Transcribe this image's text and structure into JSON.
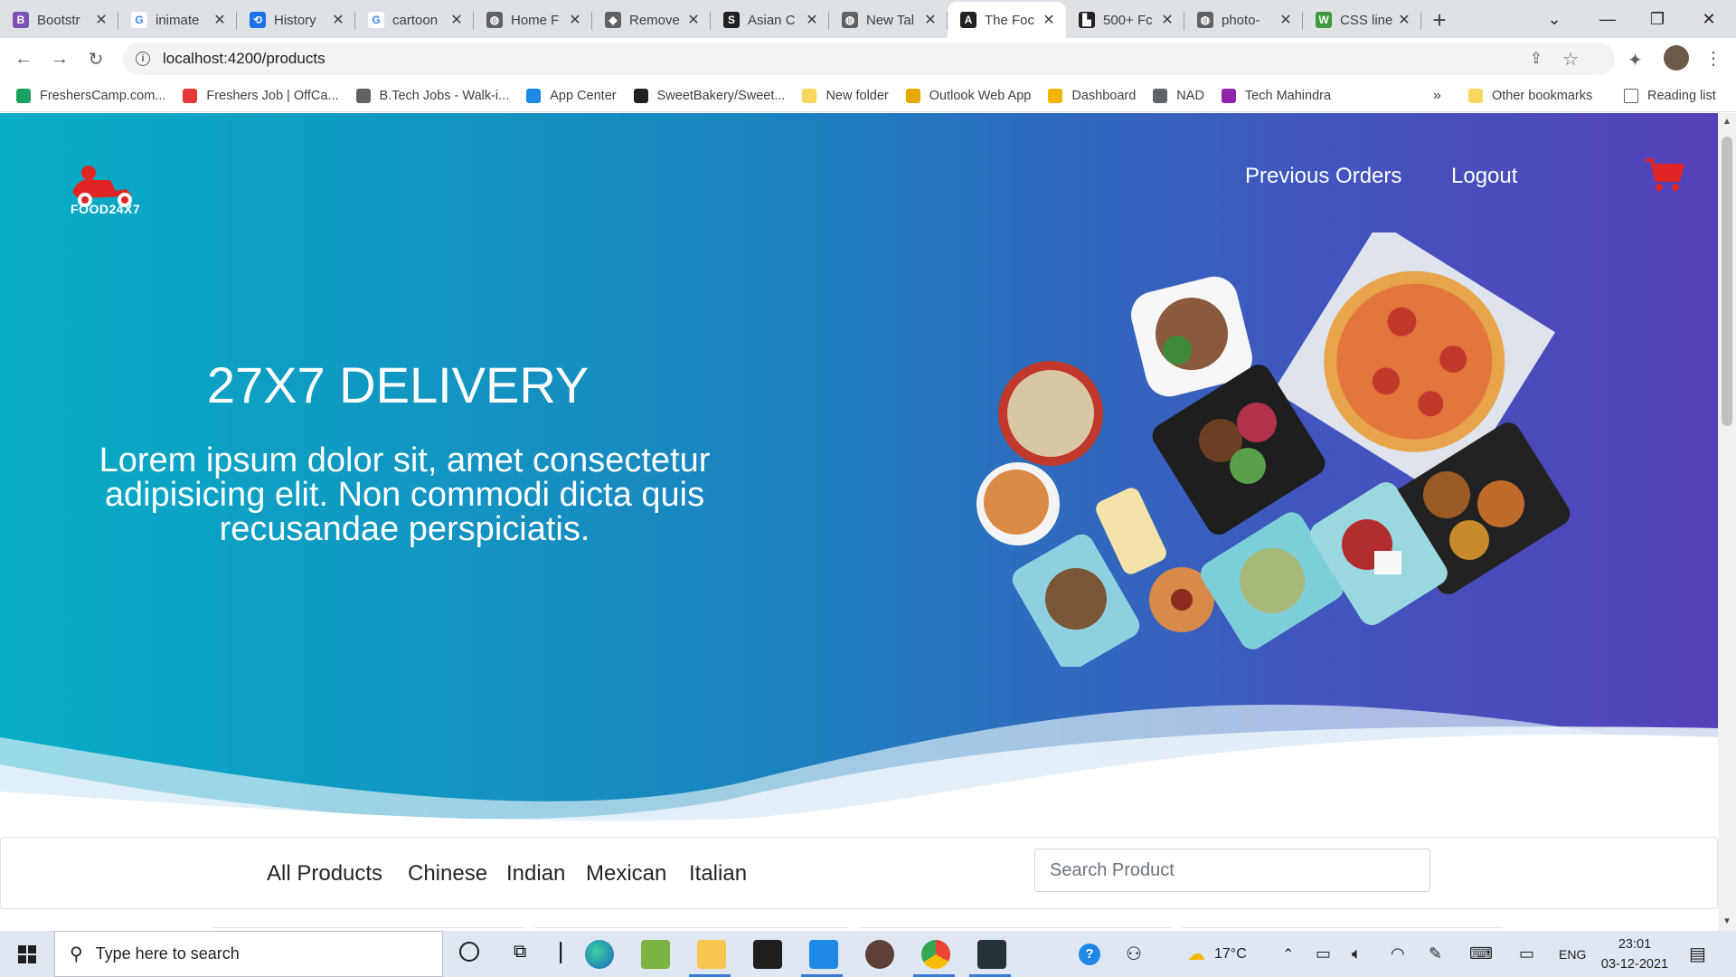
{
  "browser": {
    "tabs": [
      {
        "title": "Bootstr",
        "favicon_color": "#7952b3",
        "favicon_letter": "B",
        "active": false
      },
      {
        "title": "inimate",
        "favicon_color": "#ffffff",
        "favicon_letter": "G",
        "active": false
      },
      {
        "title": "History",
        "favicon_color": "#1a73e8",
        "favicon_letter": "⟲",
        "active": false
      },
      {
        "title": "cartoon",
        "favicon_color": "#ffffff",
        "favicon_letter": "G",
        "active": false
      },
      {
        "title": "Home F",
        "favicon_color": "#5f6368",
        "favicon_letter": "◍",
        "active": false
      },
      {
        "title": "Remove",
        "favicon_color": "#5f6368",
        "favicon_letter": "◆",
        "active": false
      },
      {
        "title": "Asian C",
        "favicon_color": "#202124",
        "favicon_letter": "S",
        "active": false
      },
      {
        "title": "New Tal",
        "favicon_color": "#5f6368",
        "favicon_letter": "◍",
        "active": false
      },
      {
        "title": "The Foc",
        "favicon_color": "#202124",
        "favicon_letter": "A",
        "active": true
      },
      {
        "title": "500+ Fc",
        "favicon_color": "#202124",
        "favicon_letter": "▙",
        "active": false
      },
      {
        "title": "photo-",
        "favicon_color": "#5f6368",
        "favicon_letter": "◍",
        "active": false
      },
      {
        "title": "CSS line",
        "favicon_color": "#3c9a3c",
        "favicon_letter": "W",
        "active": false
      }
    ],
    "url": "localhost:4200/products",
    "bookmarks": [
      {
        "label": "FreshersCamp.com...",
        "color": "#1aa260"
      },
      {
        "label": "Freshers Job | OffCa...",
        "color": "#e53935"
      },
      {
        "label": "B.Tech Jobs - Walk-i...",
        "color": "#5f6368"
      },
      {
        "label": "App Center",
        "color": "#1e88e5"
      },
      {
        "label": "SweetBakery/Sweet...",
        "color": "#202124"
      },
      {
        "label": "New folder",
        "color": "#f9d65c"
      },
      {
        "label": "Outlook Web App",
        "color": "#e6a700"
      },
      {
        "label": "Dashboard",
        "color": "#f4b400"
      },
      {
        "label": "NAD",
        "color": "#5f6368"
      },
      {
        "label": "Tech Mahindra",
        "color": "#8e24aa"
      }
    ],
    "bookmarks_overflow": "»",
    "other_bookmarks": "Other bookmarks",
    "reading_list": "Reading list"
  },
  "site": {
    "logo_text": "FOOD24X7",
    "nav": {
      "previous_orders": "Previous Orders",
      "logout": "Logout"
    },
    "hero": {
      "title": "27X7 DELIVERY",
      "text": "Lorem ipsum dolor sit, amet consectetur adipisicing elit. Non commodi dicta quis recusandae perspiciatis."
    },
    "categories": [
      "All Products",
      "Chinese",
      "Indian",
      "Mexican",
      "Italian"
    ],
    "search": {
      "placeholder": "Search Product",
      "value": ""
    },
    "colors": {
      "gradient_start": "#07adc6",
      "gradient_end": "#5541b9",
      "cart_red": "#e02424"
    }
  },
  "taskbar": {
    "search_placeholder": "Type here to search",
    "weather": "17°C",
    "language": "ENG",
    "time": "23:01",
    "date": "03-12-2021"
  }
}
